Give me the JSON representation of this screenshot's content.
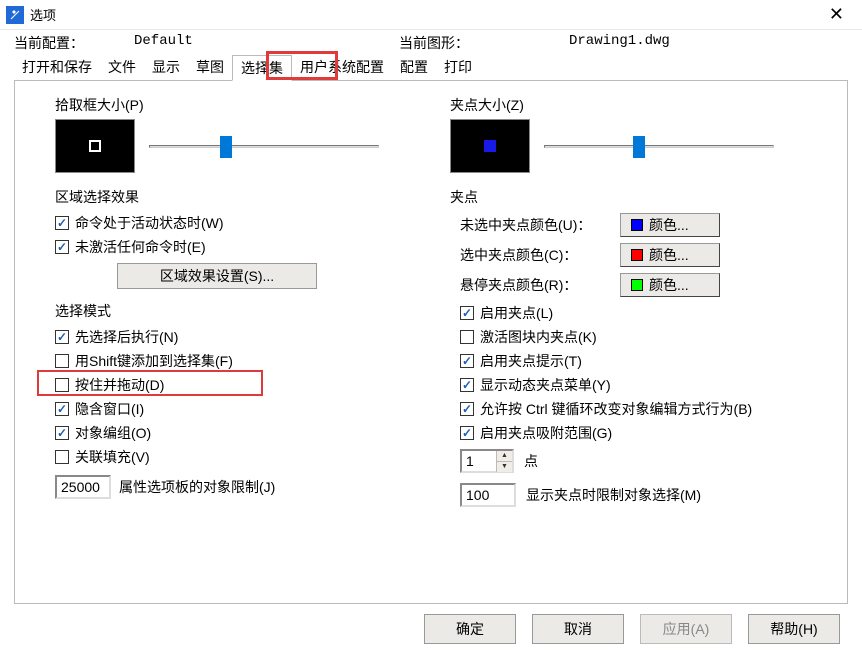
{
  "title": "选项",
  "current_config_label": "当前配置：",
  "current_config_value": "Default",
  "current_drawing_label": "当前图形：",
  "current_drawing_value": "Drawing1.dwg",
  "tabs": {
    "open_save": "打开和保存",
    "file": "文件",
    "display": "显示",
    "sketch": "草图",
    "selection": "选择集",
    "user_sys": "用户系统配置",
    "config": "配置",
    "print": "打印"
  },
  "left": {
    "pickbox_label": "拾取框大小(P)",
    "region_effect_label": "区域选择效果",
    "chk_active_cmd": "命令处于活动状态时(W)",
    "chk_no_active_cmd": "未激活任何命令时(E)",
    "region_settings_btn": "区域效果设置(S)...",
    "select_mode_label": "选择模式",
    "chk_noun_verb": "先选择后执行(N)",
    "chk_shift_add": "用Shift键添加到选择集(F)",
    "chk_press_drag": "按住并拖动(D)",
    "chk_implied_window": "隐含窗口(I)",
    "chk_object_group": "对象编组(O)",
    "chk_assoc_hatch": "关联填充(V)",
    "prop_limit_value": "25000",
    "prop_limit_label": "属性选项板的对象限制(J)"
  },
  "right": {
    "grip_size_label": "夹点大小(Z)",
    "grips_label": "夹点",
    "unsel_color_label": "未选中夹点颜色(U)：",
    "sel_color_label": "选中夹点颜色(C)：",
    "hover_color_label": "悬停夹点颜色(R)：",
    "color_btn": "颜色...",
    "colors": {
      "unsel": "#0000ff",
      "sel": "#ff0000",
      "hover": "#00ff00"
    },
    "chk_enable_grips": "启用夹点(L)",
    "chk_block_grips": "激活图块内夹点(K)",
    "chk_grip_tips": "启用夹点提示(T)",
    "chk_dyn_menu": "显示动态夹点菜单(Y)",
    "chk_ctrl_cycle": "允许按 Ctrl 键循环改变对象编辑方式行为(B)",
    "chk_grip_snap": "启用夹点吸附范围(G)",
    "spin_value": "1",
    "spin_label": "点",
    "show_grips_limit_value": "100",
    "show_grips_limit_label": "显示夹点时限制对象选择(M)"
  },
  "buttons": {
    "ok": "确定",
    "cancel": "取消",
    "apply": "应用(A)",
    "help": "帮助(H)"
  }
}
